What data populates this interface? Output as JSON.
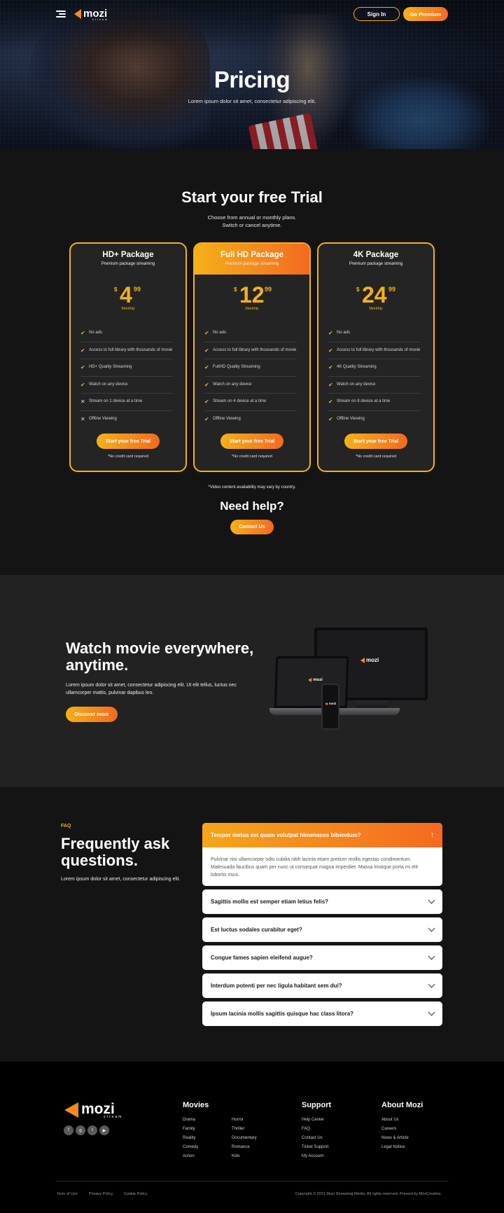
{
  "header": {
    "logo_text": "mozi",
    "logo_sub": "stream",
    "sign_in": "Sign In",
    "go_premium": "Go Premium"
  },
  "hero": {
    "title": "Pricing",
    "subtitle": "Lorem ipsum dolor sit amet, consectetur adipiscing elit."
  },
  "pricing": {
    "title": "Start your free Trial",
    "subtitle_1": "Choose from annual or monthly plans.",
    "subtitle_2": "Switch or cancel anytime.",
    "plans": [
      {
        "name": "HD+ Package",
        "tagline": "Premium package streaming",
        "currency": "$",
        "price_int": "4",
        "price_dec": "99",
        "period": "Monthly",
        "features": [
          {
            "text": "No ads",
            "included": true
          },
          {
            "text": "Access to full library with thousands of movie",
            "included": true
          },
          {
            "text": "HD+ Quality Streaming",
            "included": true
          },
          {
            "text": "Watch on any device",
            "included": true
          },
          {
            "text": "Stream on 1 device at a time",
            "included": false
          },
          {
            "text": "Offline Viewing",
            "included": false
          }
        ],
        "cta": "Start your free Trial",
        "note": "*No credit card required"
      },
      {
        "name": "Full HD Package",
        "tagline": "Premium package streaming",
        "currency": "$",
        "price_int": "12",
        "price_dec": "99",
        "period": "Monthly",
        "features": [
          {
            "text": "No ads",
            "included": true
          },
          {
            "text": "Access to full library with thousands of movie",
            "included": true
          },
          {
            "text": "FullHD Quality Streaming",
            "included": true
          },
          {
            "text": "Watch on any device",
            "included": true
          },
          {
            "text": "Stream on 4 device at a time",
            "included": true
          },
          {
            "text": "Offline Viewing",
            "included": true
          }
        ],
        "cta": "Start your free Trial",
        "note": "*No credit card required"
      },
      {
        "name": "4K Package",
        "tagline": "Premium package streaming",
        "currency": "$",
        "price_int": "24",
        "price_dec": "99",
        "period": "Monthly",
        "features": [
          {
            "text": "No ads",
            "included": true
          },
          {
            "text": "Access to full library with thousands of movie",
            "included": true
          },
          {
            "text": "4K Quality Streaming",
            "included": true
          },
          {
            "text": "Watch on any device",
            "included": true
          },
          {
            "text": "Stream on 8 device at a time",
            "included": true
          },
          {
            "text": "Offline Viewing",
            "included": true
          }
        ],
        "cta": "Start your free Trial",
        "note": "*No credit card required"
      }
    ],
    "availability_note": "*Video content availability may vary by country.",
    "need_help": "Need help?",
    "contact_us": "Contact Us"
  },
  "watch": {
    "title": "Watch movie everywhere, anytime.",
    "text": "Lorem ipsum dolor sit amet, consectetur adipiscing elit. Ut elit tellus, luctus nec ullamcorper mattis, pulvinar dapibus leo.",
    "discover": "Discover more",
    "device_logo": "mozi"
  },
  "faq": {
    "tag": "FAQ",
    "title": "Frequently ask questions.",
    "text": "Lorem ipsum dolor sit amet, consectetur adipiscing elit.",
    "items": [
      {
        "question": "Tempor metus est quam volutpat himenaeos bibendum?",
        "answer": "Pulvinar nisi ullamcorper odio cubilia nibh lacinia etiam pretium mollis egestas condimentum. Malesuada faucibus quam per nunc ut consequat magna imperdiet. Massa tristique porta mi elit lobortis risus.",
        "open": true
      },
      {
        "question": "Sagittis mollis est semper etiam letius felis?",
        "open": false
      },
      {
        "question": "Est luctus sodales curabitur eget?",
        "open": false
      },
      {
        "question": "Congue fames sapien eleifend augue?",
        "open": false
      },
      {
        "question": "Interdum potenti per nec ligula habitant sem dui?",
        "open": false
      },
      {
        "question": "Ipsum lacinia mollis sagittis quisque hac class litora?",
        "open": false
      }
    ]
  },
  "footer": {
    "logo_text": "mozi",
    "logo_sub": "stream",
    "socials": [
      "facebook-icon",
      "instagram-icon",
      "twitter-icon",
      "youtube-icon"
    ],
    "columns": [
      {
        "title": "Movies",
        "links_a": [
          "Drama",
          "Family",
          "Reality",
          "Comedy",
          "Action"
        ],
        "links_b": [
          "Horror",
          "Thriller",
          "Documentary",
          "Romance",
          "Kids"
        ]
      },
      {
        "title": "Support",
        "links": [
          "Help Center",
          "FAQ",
          "Contact Us",
          "Ticket Support",
          "My Account"
        ]
      },
      {
        "title": "About Mozi",
        "links": [
          "About Us",
          "Careers",
          "News & Article",
          "Legal Notice"
        ]
      }
    ],
    "bottom_links": [
      "Term of Use",
      "Privacy Policy",
      "Cookie Policy"
    ],
    "copyright": "Copyright © 2021 Mozi Streaming Media. All rights reserved. Present by MoxCreative."
  },
  "colors": {
    "accent": "#f5b019",
    "accent_end": "#f36a21",
    "background": "#141414",
    "panel": "#242424"
  }
}
